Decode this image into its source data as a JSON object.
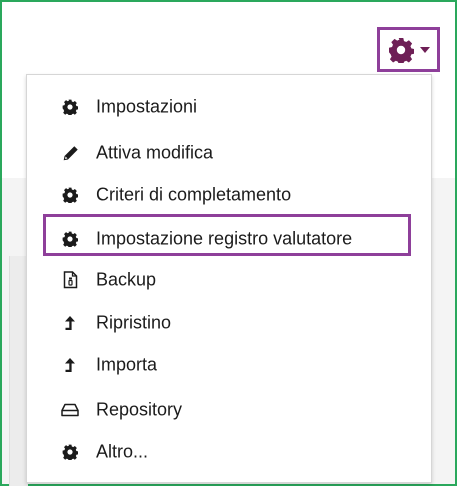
{
  "colors": {
    "frame_border": "#2aa85c",
    "highlight": "#8e3f9a",
    "icon": "#1b1b1b",
    "gear_icon": "#6e1f56"
  },
  "toolbar": {
    "gear_icon": "gear-icon",
    "caret_icon": "caret-down-icon"
  },
  "menu": {
    "items": [
      {
        "label": "Impostazioni",
        "icon": "gear-icon"
      },
      {
        "label": "Attiva modifica",
        "icon": "pencil-icon"
      },
      {
        "label": "Criteri di completamento",
        "icon": "gear-icon"
      },
      {
        "label": "Impostazione registro valutatore",
        "icon": "gear-icon"
      },
      {
        "label": "Backup",
        "icon": "backup-file-icon"
      },
      {
        "label": "Ripristino",
        "icon": "upload-arrow-icon"
      },
      {
        "label": "Importa",
        "icon": "upload-arrow-icon"
      },
      {
        "label": "Repository",
        "icon": "drive-icon"
      },
      {
        "label": "Altro...",
        "icon": "gear-icon"
      }
    ]
  }
}
